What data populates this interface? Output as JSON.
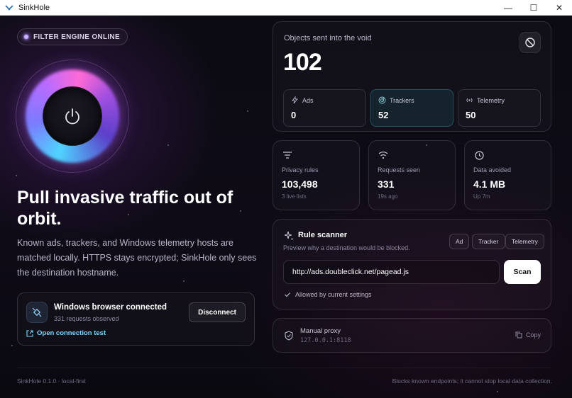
{
  "window": {
    "title": "SinkHole",
    "minimize": "—",
    "maximize": "☐",
    "close": "✕"
  },
  "status": {
    "label": "FILTER ENGINE ONLINE"
  },
  "hero": {
    "headline": "Pull invasive traffic out of orbit.",
    "description": "Known ads, trackers, and Windows telemetry hosts are matched locally. HTTPS stays encrypted; SinkHole only sees the destination hostname."
  },
  "connection": {
    "title": "Windows browser connected",
    "subtitle": "331 requests observed",
    "disconnect_label": "Disconnect",
    "test_link": "Open connection test"
  },
  "void": {
    "label": "Objects sent into the void",
    "count": "102",
    "categories": [
      {
        "label": "Ads",
        "value": "0",
        "icon": "bolt-icon"
      },
      {
        "label": "Trackers",
        "value": "52",
        "icon": "radar-icon"
      },
      {
        "label": "Telemetry",
        "value": "50",
        "icon": "broadcast-icon"
      }
    ]
  },
  "stats": [
    {
      "label": "Privacy rules",
      "value": "103,498",
      "sub": "3 live lists",
      "icon": "filter-icon"
    },
    {
      "label": "Requests seen",
      "value": "331",
      "sub": "19s ago",
      "icon": "wifi-icon"
    },
    {
      "label": "Data avoided",
      "value": "4.1 MB",
      "sub": "Up 7m",
      "icon": "clock-icon"
    }
  ],
  "scanner": {
    "title": "Rule scanner",
    "subtitle": "Preview why a destination would be blocked.",
    "chips": [
      "Ad",
      "Tracker",
      "Telemetry"
    ],
    "input_value": "http://ads.doubleclick.net/pagead.js",
    "scan_label": "Scan",
    "result": "Allowed by current settings"
  },
  "proxy": {
    "label": "Manual proxy",
    "value": "127.0.0.1:8118",
    "copy_label": "Copy"
  },
  "footer": {
    "left": "SinkHole 0.1.0 · local-first",
    "right": "Blocks known endpoints; it cannot stop local data collection."
  }
}
